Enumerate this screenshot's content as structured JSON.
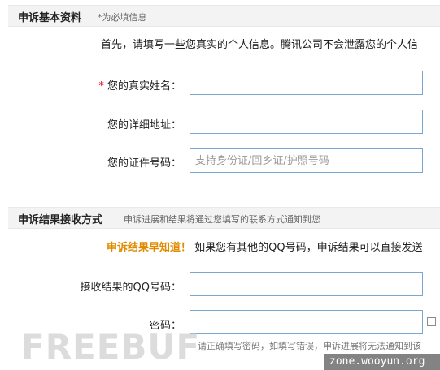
{
  "section1": {
    "title": "申诉基本资料",
    "note": "*为必填信息",
    "intro": "首先，请填写一些您真实的个人信息。腾讯公司不会泄露您的个人信",
    "fields": [
      {
        "required": "*",
        "label": "您的真实姓名：",
        "value": "",
        "placeholder": ""
      },
      {
        "required": "",
        "label": "您的详细地址：",
        "value": "",
        "placeholder": ""
      },
      {
        "required": "",
        "label": "您的证件号码：",
        "value": "",
        "placeholder": "支持身份证/回乡证/护照号码"
      }
    ]
  },
  "section2": {
    "title": "申诉结果接收方式",
    "note": "申诉进展和结果将通过您填写的联系方式通知到您",
    "promo_strong": "申诉结果早知道！",
    "promo_text": "如果您有其他的QQ号码，申诉结果可以直接发送",
    "fields": [
      {
        "label": "接收结果的QQ号码：",
        "value": "",
        "placeholder": ""
      },
      {
        "label": "密码：",
        "value": "",
        "placeholder": ""
      }
    ],
    "hint": "请正确填写密码，如填写错误，申诉进展将无法通知到该"
  },
  "watermark": {
    "logo_text": "FREEBUF",
    "site": "zone.wooyun.org"
  },
  "colors": {
    "header_bg": "#f3f3f3",
    "field_border": "#7aa7cf",
    "required": "#e60012",
    "promo": "#e08a00"
  }
}
